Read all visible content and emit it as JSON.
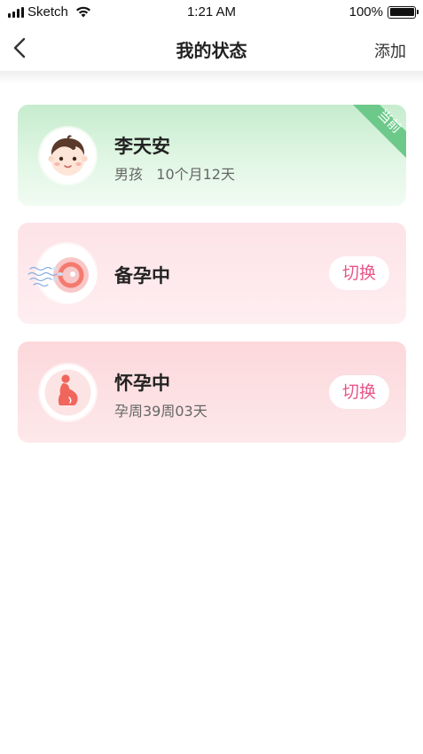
{
  "status_bar": {
    "carrier": "Sketch",
    "time": "1:21 AM",
    "battery": "100%",
    "battery_level": 1.0
  },
  "nav": {
    "title": "我的状态",
    "add_label": "添加",
    "back_icon": "chevron-left-icon"
  },
  "cards": [
    {
      "name": "李天安",
      "sub": "男孩   10个月12天",
      "badge": "当前",
      "icon": "baby-face-icon",
      "accent": "#6cc98a"
    },
    {
      "name": "备孕中",
      "switch_label": "切换",
      "icon": "ovum-sperm-icon",
      "accent": "#e8578a"
    },
    {
      "name": "怀孕中",
      "sub": "孕周39周03天",
      "switch_label": "切换",
      "icon": "pregnant-woman-icon",
      "accent": "#e8578a"
    }
  ]
}
